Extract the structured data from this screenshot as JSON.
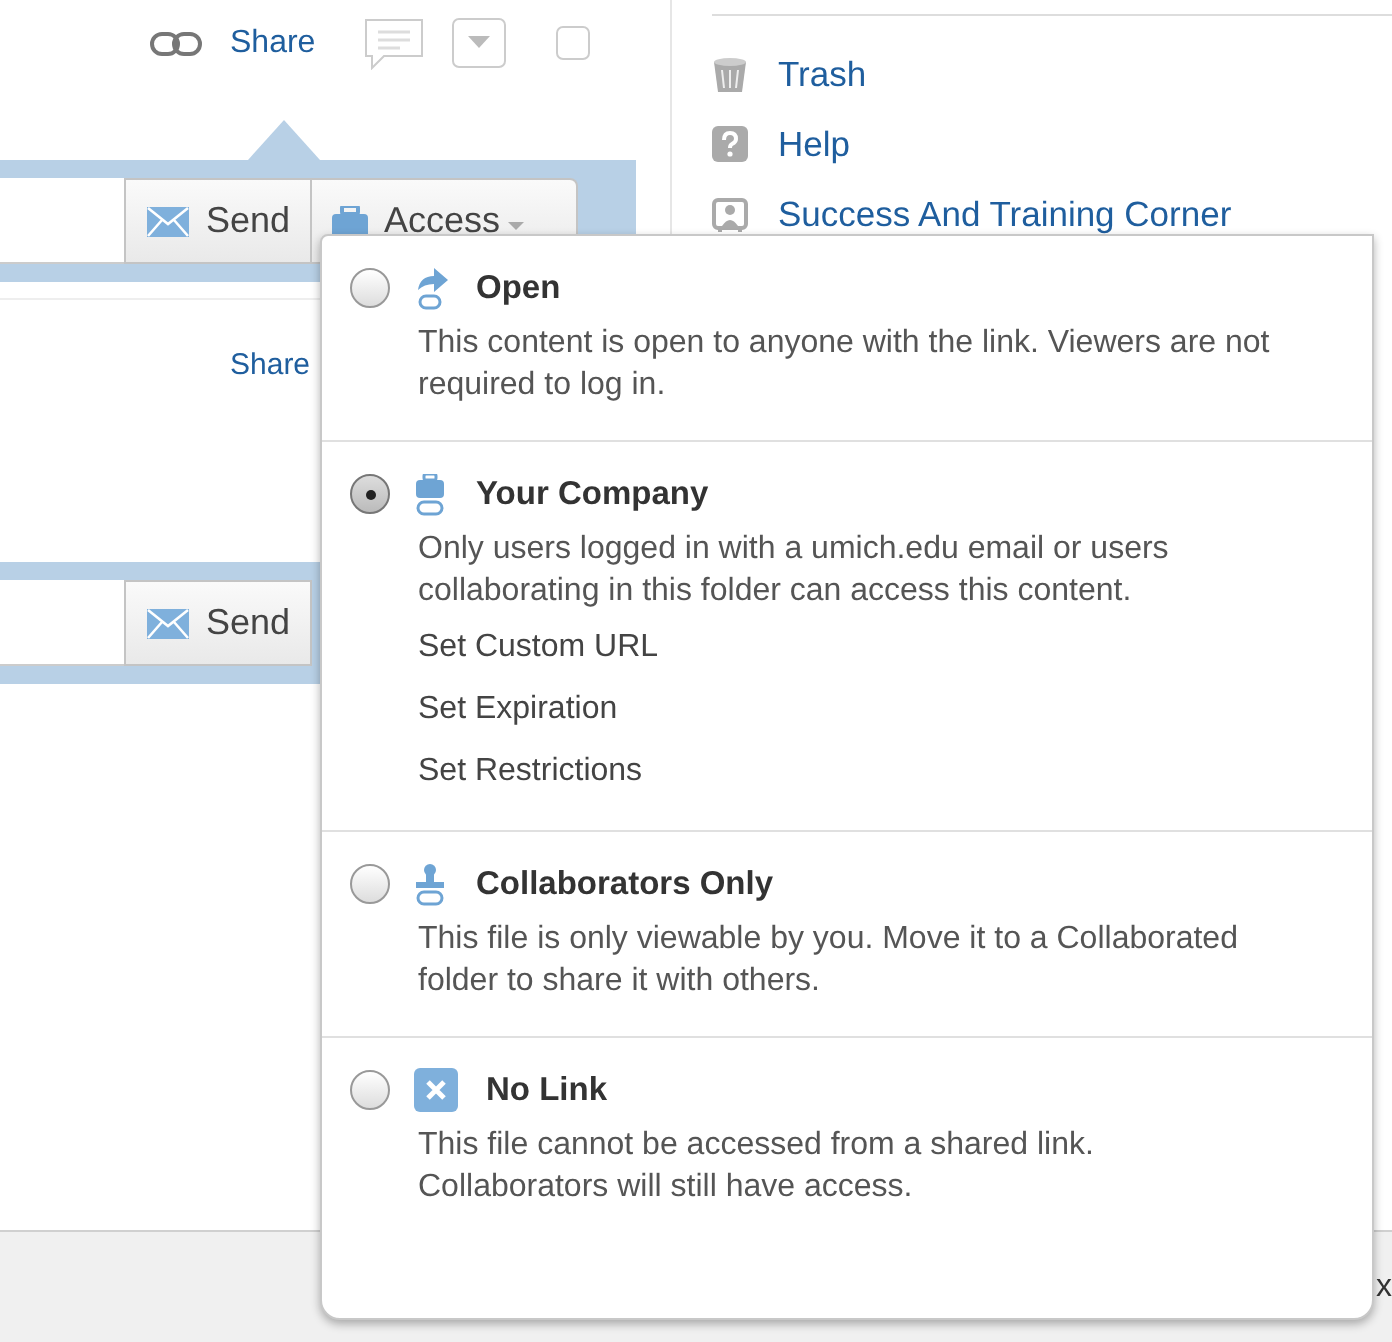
{
  "toolbar": {
    "share_link": "Share"
  },
  "share_bar": {
    "send_button": "Send",
    "access_button": "Access"
  },
  "second_share_link": "Share",
  "second_share_bar": {
    "send_button": "Send"
  },
  "sidebar": {
    "items": [
      {
        "kind": "trash",
        "label": "Trash"
      },
      {
        "kind": "help",
        "label": "Help"
      },
      {
        "kind": "training",
        "label": "Success And Training Corner"
      }
    ]
  },
  "access_menu": {
    "options": [
      {
        "kind": "open",
        "title": "Open",
        "description": "This content is open to anyone with the link. Viewers are not required to log in.",
        "selected": false
      },
      {
        "kind": "company",
        "title": "Your Company",
        "description": "Only users logged in with a umich.edu email or users collaborating in this folder can access this content.",
        "selected": true,
        "actions": [
          "Set Custom URL",
          "Set Expiration",
          "Set Restrictions"
        ]
      },
      {
        "kind": "collaborators",
        "title": "Collaborators Only",
        "description": "This file is only viewable by you. Move it to a Collaborated folder to share it with others.",
        "selected": false
      },
      {
        "kind": "nolink",
        "title": "No Link",
        "description": "This file cannot be accessed from a shared link. Collaborators will still have access.",
        "selected": false
      }
    ]
  },
  "footer": {
    "close_mark": "x"
  }
}
